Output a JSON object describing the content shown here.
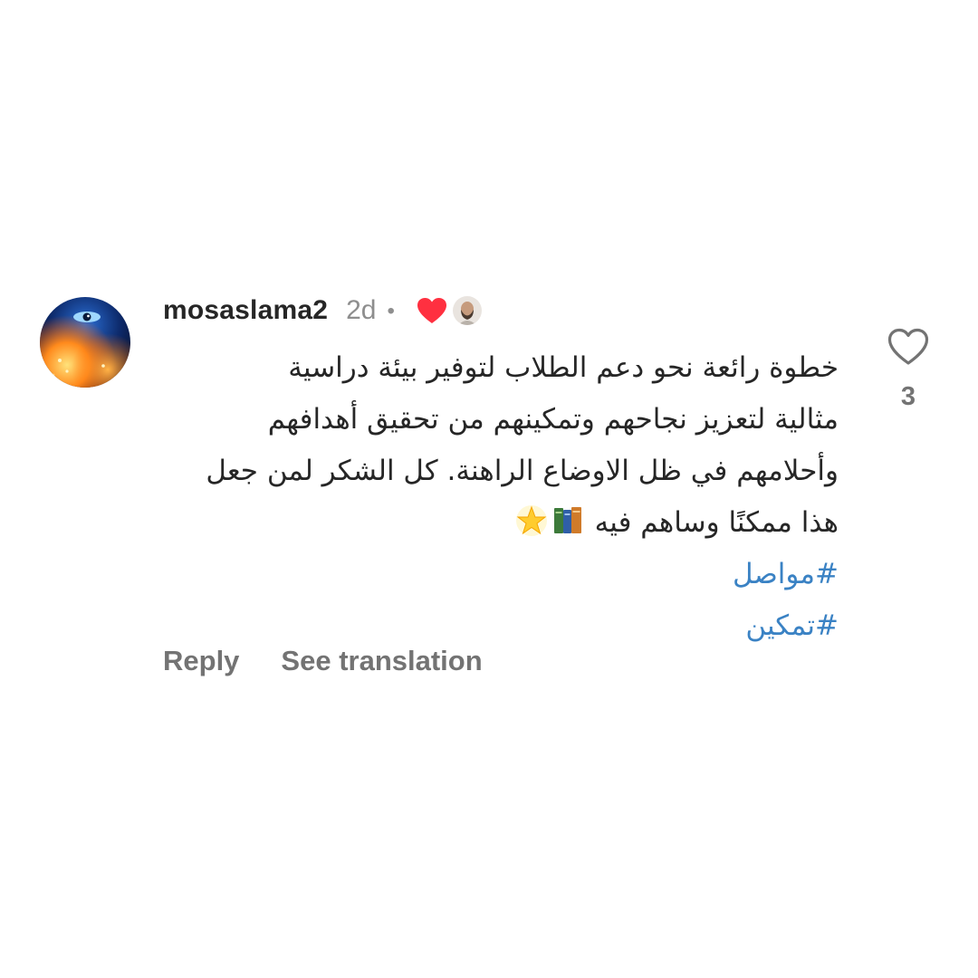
{
  "comment": {
    "username": "mosaslama2",
    "time": "2d",
    "separator": "•",
    "lines": [
      "خطوة رائعة نحو دعم الطلاب لتوفير بيئة دراسية",
      "مثالية لتعزيز نجاحهم وتمكينهم من تحقيق أهدافهم",
      "وأحلامهم في ظل الاوضاع الراهنة. كل الشكر لمن جعل",
      "هذا ممكنًا وساهم فيه"
    ],
    "hashtags": [
      "#مواصل",
      "#تمكين"
    ],
    "like_count": "3"
  },
  "actions": {
    "reply_label": "Reply",
    "translate_label": "See translation"
  },
  "icons": {
    "like": "heart-outline-icon",
    "author_liked": "heart-filled-icon",
    "emoji_1": "books-emoji",
    "emoji_2": "glowing-star-emoji"
  },
  "colors": {
    "text": "#262626",
    "muted": "#737373",
    "hashtag": "#3a82c4",
    "heart": "#ff3040"
  }
}
